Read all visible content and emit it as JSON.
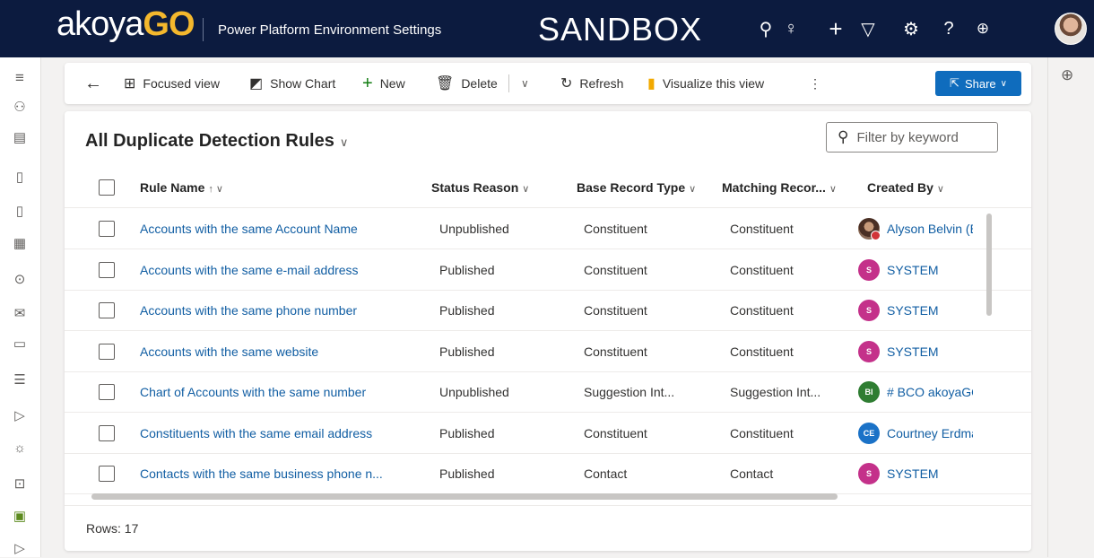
{
  "topbar": {
    "brand_text": "akoya",
    "brand_accent": "GO",
    "app_title": "Power Platform Environment Settings",
    "environment": "SANDBOX",
    "icons": [
      "search-icon",
      "lightbulb-icon",
      "plus-icon",
      "filter-icon",
      "gear-icon",
      "help-icon",
      "copilot-icon",
      "user-avatar"
    ]
  },
  "leftnav": {
    "icons": [
      "hamburger-icon",
      "people-icon",
      "entities-icon",
      "document-settings-icon",
      "document-icon",
      "form-icon",
      "lock-icon",
      "mail-icon",
      "chat-settings-icon",
      "list-settings-icon",
      "expand-icon",
      "lightbulb-icon",
      "code-icon",
      "folder-check-icon",
      "expand-icon"
    ]
  },
  "commandbar": {
    "back": "←",
    "focused_view": "Focused view",
    "show_chart": "Show Chart",
    "new": "New",
    "delete": "Delete",
    "refresh": "Refresh",
    "visualize": "Visualize this view",
    "more": "⋮",
    "share": "Share"
  },
  "view": {
    "title": "All Duplicate Detection Rules",
    "filter_placeholder": "Filter by keyword"
  },
  "columns": {
    "rule_name": "Rule Name",
    "status_reason": "Status Reason",
    "base_record_type": "Base Record Type",
    "matching_record": "Matching Recor...",
    "created_by": "Created By"
  },
  "rows": [
    {
      "name": "Accounts with the same Account Name",
      "status": "Unpublished",
      "base": "Constituent",
      "matching": "Constituent",
      "creator": "Alyson Belvin (B",
      "initials": "",
      "avatar_color": "photo"
    },
    {
      "name": "Accounts with the same e-mail address",
      "status": "Published",
      "base": "Constituent",
      "matching": "Constituent",
      "creator": "SYSTEM",
      "initials": "S",
      "avatar_color": "#c4318a"
    },
    {
      "name": "Accounts with the same phone number",
      "status": "Published",
      "base": "Constituent",
      "matching": "Constituent",
      "creator": "SYSTEM",
      "initials": "S",
      "avatar_color": "#c4318a"
    },
    {
      "name": "Accounts with the same website",
      "status": "Published",
      "base": "Constituent",
      "matching": "Constituent",
      "creator": "SYSTEM",
      "initials": "S",
      "avatar_color": "#c4318a"
    },
    {
      "name": "Chart of Accounts with the same number",
      "status": "Unpublished",
      "base": "Suggestion Int...",
      "matching": "Suggestion Int...",
      "creator": "# BCO akoyaGO",
      "initials": "BI",
      "avatar_color": "#2f7d32"
    },
    {
      "name": "Constituents with the same email address",
      "status": "Published",
      "base": "Constituent",
      "matching": "Constituent",
      "creator": "Courtney Erdma",
      "initials": "CE",
      "avatar_color": "#1b72c7"
    },
    {
      "name": "Contacts with the same business phone n...",
      "status": "Published",
      "base": "Contact",
      "matching": "Contact",
      "creator": "SYSTEM",
      "initials": "S",
      "avatar_color": "#c4318a"
    }
  ],
  "footer": {
    "rows_count": "Rows: 17"
  },
  "colors": {
    "topbar_bg": "#0c1b3f",
    "brand_accent": "#f4b82d",
    "link": "#115ea3",
    "share_button": "#0f6cbd"
  }
}
